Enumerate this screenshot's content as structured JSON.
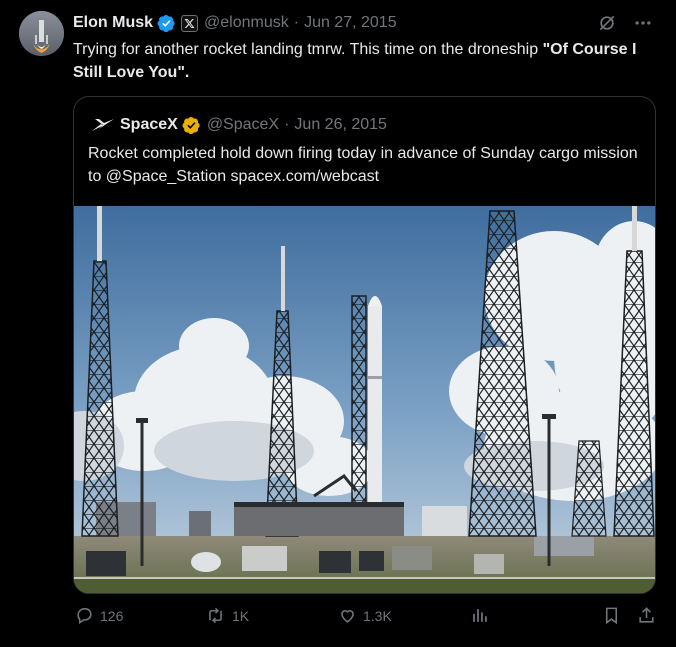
{
  "tweet": {
    "author_name": "Elon Musk",
    "handle": "@elonmusk",
    "separator": "·",
    "date": "Jun 27, 2015",
    "text_plain": "Trying for another rocket landing tmrw. This time on the droneship ",
    "text_bold": "\"Of Course I Still Love You\".",
    "verified_color": "#1d9bf0"
  },
  "quoted": {
    "author_name": "SpaceX",
    "handle": "@SpaceX",
    "separator": "·",
    "date": "Jun 26, 2015",
    "text": "Rocket completed hold down firing today in advance of Sunday cargo mission to @Space_Station spacex.com/webcast",
    "verified_color": "#e8b006"
  },
  "actions": {
    "replies": "126",
    "reposts": "1K",
    "likes": "1.3K"
  },
  "icons": [
    "grok-icon",
    "more-icon",
    "reply-icon",
    "repost-icon",
    "like-icon",
    "views-icon",
    "bookmark-icon",
    "share-icon"
  ]
}
